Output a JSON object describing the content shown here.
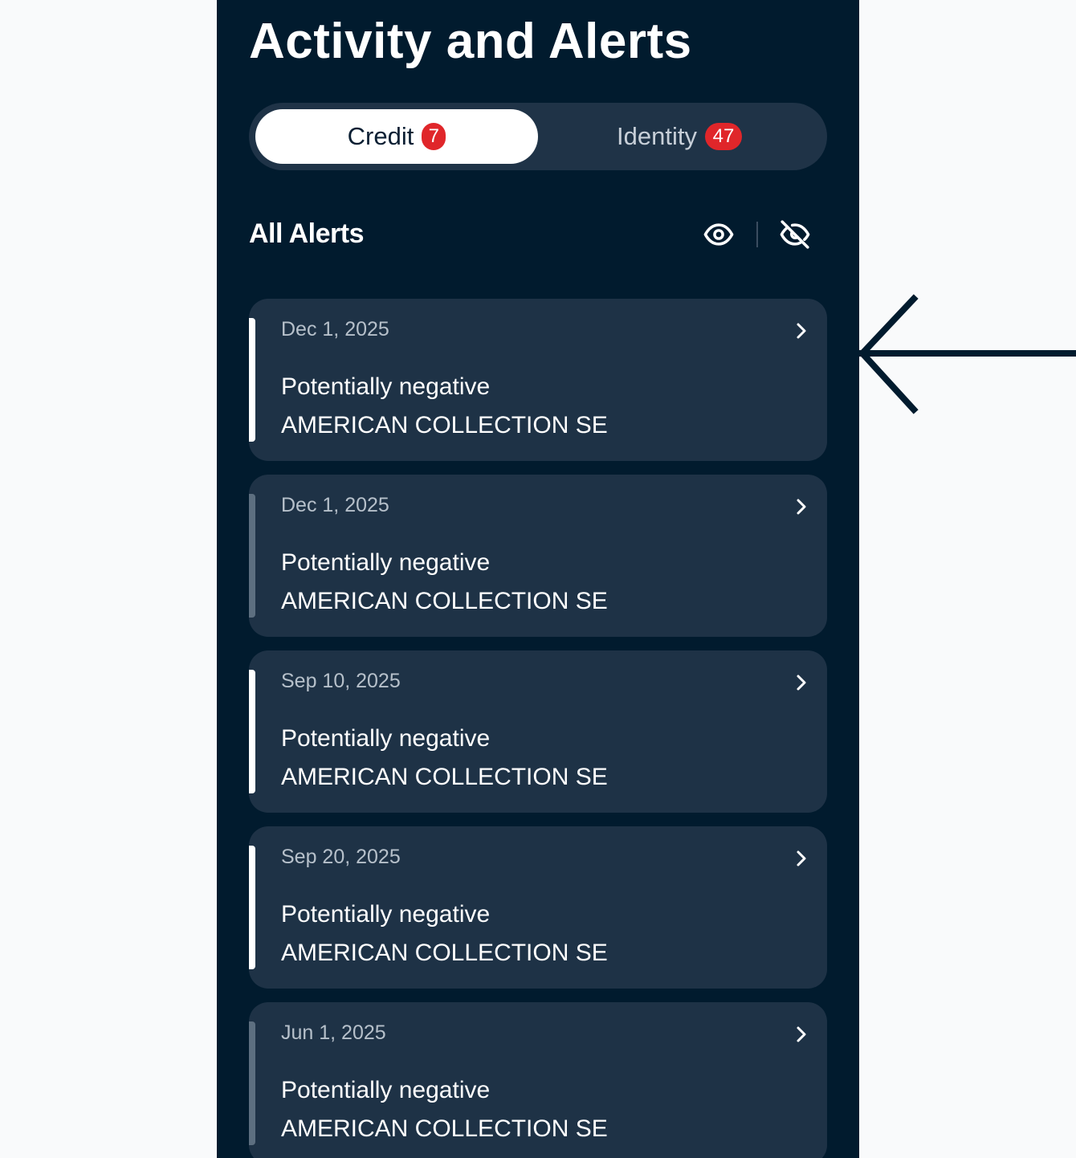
{
  "header": {
    "title": "Activity and Alerts"
  },
  "tabs": [
    {
      "label": "Credit",
      "badge": "7",
      "selected": true
    },
    {
      "label": "Identity",
      "badge": "47",
      "selected": false
    }
  ],
  "section": {
    "title": "All Alerts",
    "icons": [
      "eye-icon",
      "eye-off-icon"
    ]
  },
  "alerts": [
    {
      "date": "Dec 1, 2025",
      "type": "Potentially negative",
      "company": "AMERICAN COLLECTION SE",
      "unread": true
    },
    {
      "date": "Dec 1, 2025",
      "type": "Potentially negative",
      "company": "AMERICAN COLLECTION SE",
      "unread": false
    },
    {
      "date": "Sep 10, 2025",
      "type": "Potentially negative",
      "company": "AMERICAN COLLECTION SE",
      "unread": true
    },
    {
      "date": "Sep 20, 2025",
      "type": "Potentially negative",
      "company": "AMERICAN COLLECTION SE",
      "unread": true
    },
    {
      "date": "Jun 1, 2025",
      "type": "Potentially negative",
      "company": "AMERICAN COLLECTION SE",
      "unread": false
    }
  ],
  "colors": {
    "screen_background": "#011b2e",
    "card_background": "#1e3246",
    "badge": "#e0262a",
    "unread_accent": "#ffffff",
    "read_accent": "#5d6f80",
    "page_background": "#f9fafb"
  }
}
